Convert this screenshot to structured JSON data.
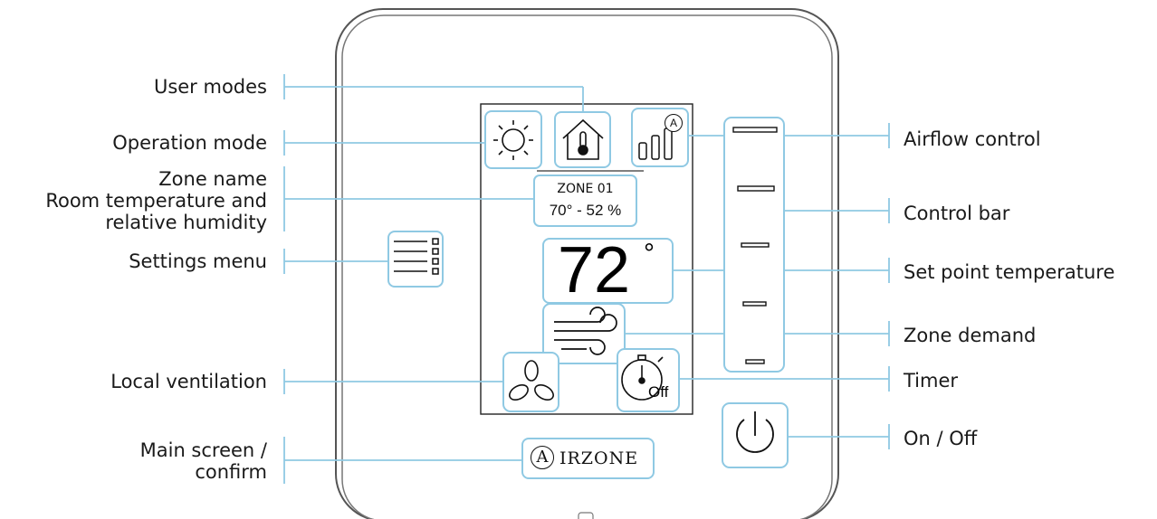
{
  "labels": {
    "user_modes": "User modes",
    "operation_mode": "Operation mode",
    "zone_name": "Zone name",
    "room_temp_line1": "Room temperature and",
    "room_temp_line2": "relative humidity",
    "settings_menu": "Settings menu",
    "local_ventilation": "Local ventilation",
    "main_screen_line1": "Main screen /",
    "main_screen_line2": "confirm",
    "airflow_control": "Airflow control",
    "control_bar": "Control bar",
    "set_point_temperature": "Set point temperature",
    "zone_demand": "Zone demand",
    "timer": "Timer",
    "on_off": "On / Off"
  },
  "screen": {
    "zone_name": "ZONE 01",
    "room_reading": "70° - 52 %",
    "setpoint": "72",
    "degree_symbol": "°",
    "timer_state": "Off",
    "airflow_mode_letter": "A"
  },
  "brand": {
    "initial": "A",
    "rest": "IRZONE"
  },
  "icons": [
    "sun-icon",
    "house-thermometer-icon",
    "airflow-bars-icon",
    "menu-list-icon",
    "fan-icon",
    "wind-icon",
    "timer-icon",
    "power-icon"
  ],
  "colors": {
    "accent": "#8fc9e3",
    "outline": "#444444"
  }
}
